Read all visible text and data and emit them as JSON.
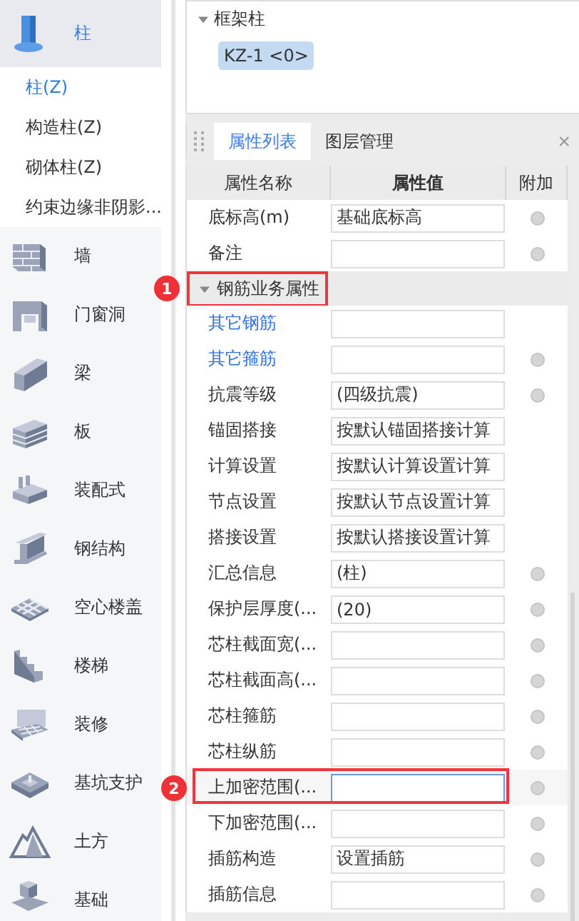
{
  "sidebar": {
    "categories": [
      {
        "label": "柱",
        "selected": true,
        "children": [
          {
            "label": "柱(Z)",
            "selected": true
          },
          {
            "label": "构造柱(Z)",
            "selected": false
          },
          {
            "label": "砌体柱(Z)",
            "selected": false
          },
          {
            "label": "约束边缘非阴影...",
            "selected": false
          }
        ]
      },
      {
        "label": "墙",
        "selected": false
      },
      {
        "label": "门窗洞",
        "selected": false
      },
      {
        "label": "梁",
        "selected": false
      },
      {
        "label": "板",
        "selected": false
      },
      {
        "label": "装配式",
        "selected": false
      },
      {
        "label": "钢结构",
        "selected": false
      },
      {
        "label": "空心楼盖",
        "selected": false
      },
      {
        "label": "楼梯",
        "selected": false
      },
      {
        "label": "装修",
        "selected": false
      },
      {
        "label": "基坑支护",
        "selected": false
      },
      {
        "label": "土方",
        "selected": false
      },
      {
        "label": "基础",
        "selected": false
      }
    ]
  },
  "tree": {
    "label": "框架柱",
    "expanded": true,
    "items": [
      {
        "label": "KZ-1 <0>",
        "selected": true
      }
    ]
  },
  "tabs": [
    {
      "label": "属性列表",
      "selected": true
    },
    {
      "label": "图层管理",
      "selected": false
    }
  ],
  "close_glyph": "×",
  "table": {
    "columns": [
      "属性名称",
      "属性值",
      "附加"
    ],
    "rows": [
      {
        "kind": "prop",
        "name": "底标高(m)",
        "value": "基础底标高",
        "linked": false,
        "attach": true,
        "focused": false,
        "marked": false
      },
      {
        "kind": "prop",
        "name": "备注",
        "linked": false,
        "attach": true,
        "focused": false,
        "marked": false
      },
      {
        "kind": "section",
        "name": "钢筋业务属性",
        "expanded": true,
        "marked": true,
        "badge": "1"
      },
      {
        "kind": "prop",
        "name": "其它钢筋",
        "linked": true,
        "attach": false,
        "focused": false,
        "marked": false
      },
      {
        "kind": "prop",
        "name": "其它箍筋",
        "linked": true,
        "attach": true,
        "focused": false,
        "marked": false
      },
      {
        "kind": "prop",
        "name": "抗震等级",
        "value": "(四级抗震)",
        "linked": false,
        "attach": true,
        "focused": false,
        "marked": false
      },
      {
        "kind": "prop",
        "name": "锚固搭接",
        "value": "按默认锚固搭接计算",
        "linked": false,
        "attach": false,
        "focused": false,
        "marked": false
      },
      {
        "kind": "prop",
        "name": "计算设置",
        "value": "按默认计算设置计算",
        "linked": false,
        "attach": false,
        "focused": false,
        "marked": false
      },
      {
        "kind": "prop",
        "name": "节点设置",
        "value": "按默认节点设置计算",
        "linked": false,
        "attach": false,
        "focused": false,
        "marked": false
      },
      {
        "kind": "prop",
        "name": "搭接设置",
        "value": "按默认搭接设置计算",
        "linked": false,
        "attach": false,
        "focused": false,
        "marked": false
      },
      {
        "kind": "prop",
        "name": "汇总信息",
        "value": "(柱)",
        "linked": false,
        "attach": true,
        "focused": false,
        "marked": false
      },
      {
        "kind": "prop",
        "name": "保护层厚度(...",
        "value": "(20)",
        "linked": false,
        "attach": true,
        "focused": false,
        "marked": false
      },
      {
        "kind": "prop",
        "name": "芯柱截面宽(...",
        "linked": false,
        "attach": true,
        "focused": false,
        "marked": false
      },
      {
        "kind": "prop",
        "name": "芯柱截面高(...",
        "linked": false,
        "attach": true,
        "focused": false,
        "marked": false
      },
      {
        "kind": "prop",
        "name": "芯柱箍筋",
        "linked": false,
        "attach": true,
        "focused": false,
        "marked": false
      },
      {
        "kind": "prop",
        "name": "芯柱纵筋",
        "linked": false,
        "attach": true,
        "focused": false,
        "marked": false
      },
      {
        "kind": "prop",
        "name": "上加密范围(...",
        "linked": false,
        "attach": true,
        "focused": true,
        "marked": true,
        "badge": "2"
      },
      {
        "kind": "prop",
        "name": "下加密范围(...",
        "linked": false,
        "attach": true,
        "focused": false,
        "marked": false
      },
      {
        "kind": "prop",
        "name": "插筋构造",
        "value": "设置插筋",
        "linked": false,
        "attach": true,
        "focused": false,
        "marked": false
      },
      {
        "kind": "prop",
        "name": "插筋信息",
        "linked": false,
        "attach": true,
        "focused": false,
        "marked": false
      }
    ]
  }
}
